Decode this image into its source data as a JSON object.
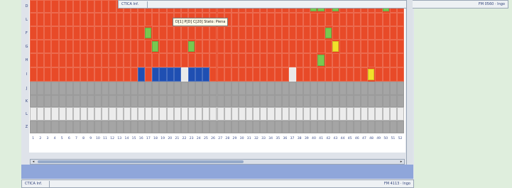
{
  "top_status": {
    "left": "CTICA Inf.",
    "right": "FM 0560 · Ingo"
  },
  "bottom_status": {
    "left": "CTICA Inf.",
    "right": "FM 4113 · Ingo"
  },
  "tooltip": "D[1] P[D] C[20] Stato: Piena",
  "colors": {
    "red": "#e84a28",
    "green": "#78c850",
    "yellow": "#f2e02a",
    "blue": "#1f4fb2",
    "white": "#e9e9e9",
    "gray": "#a5a5a5",
    "light": "#d8d8d8"
  },
  "row_labels": [
    "D",
    "L",
    "F",
    "G",
    "H",
    "I",
    "J",
    "K",
    "L",
    "Z"
  ],
  "rows": [
    {
      "type": "red",
      "cells": [
        {
          "c": 40,
          "s": "green"
        },
        {
          "c": 41,
          "s": "green"
        },
        {
          "c": 43,
          "s": "green"
        },
        {
          "c": 50,
          "s": "green"
        }
      ]
    },
    {
      "type": "red",
      "cells": []
    },
    {
      "type": "red",
      "cells": [
        {
          "c": 17,
          "s": "green"
        },
        {
          "c": 42,
          "s": "green"
        }
      ]
    },
    {
      "type": "red",
      "cells": [
        {
          "c": 18,
          "s": "green"
        },
        {
          "c": 23,
          "s": "green"
        },
        {
          "c": 43,
          "s": "yellow"
        }
      ]
    },
    {
      "type": "red",
      "cells": [
        {
          "c": 41,
          "s": "green"
        }
      ]
    },
    {
      "type": "red",
      "cells": [
        {
          "c": 16,
          "s": "blue"
        },
        {
          "c": 18,
          "s": "blue"
        },
        {
          "c": 19,
          "s": "blue"
        },
        {
          "c": 20,
          "s": "blue"
        },
        {
          "c": 21,
          "s": "blue"
        },
        {
          "c": 22,
          "s": "white"
        },
        {
          "c": 23,
          "s": "blue"
        },
        {
          "c": 24,
          "s": "blue"
        },
        {
          "c": 25,
          "s": "blue"
        },
        {
          "c": 37,
          "s": "white"
        },
        {
          "c": 48,
          "s": "yellow"
        }
      ]
    },
    {
      "type": "gray",
      "cells": []
    },
    {
      "type": "gray",
      "cells": []
    },
    {
      "type": "light",
      "cells": []
    },
    {
      "type": "gray",
      "cells": []
    }
  ],
  "column_numbers": [
    "1",
    "2",
    "3",
    "4",
    "5",
    "6",
    "7",
    "8",
    "9",
    "10",
    "11",
    "12",
    "13",
    "14",
    "15",
    "16",
    "17",
    "18",
    "19",
    "20",
    "21",
    "22",
    "23",
    "24",
    "25",
    "26",
    "27",
    "28",
    "29",
    "30",
    "31",
    "32",
    "33",
    "34",
    "35",
    "36",
    "37",
    "38",
    "39",
    "40",
    "41",
    "42",
    "43",
    "44",
    "45",
    "46",
    "47",
    "48",
    "49",
    "50",
    "51",
    "52"
  ]
}
